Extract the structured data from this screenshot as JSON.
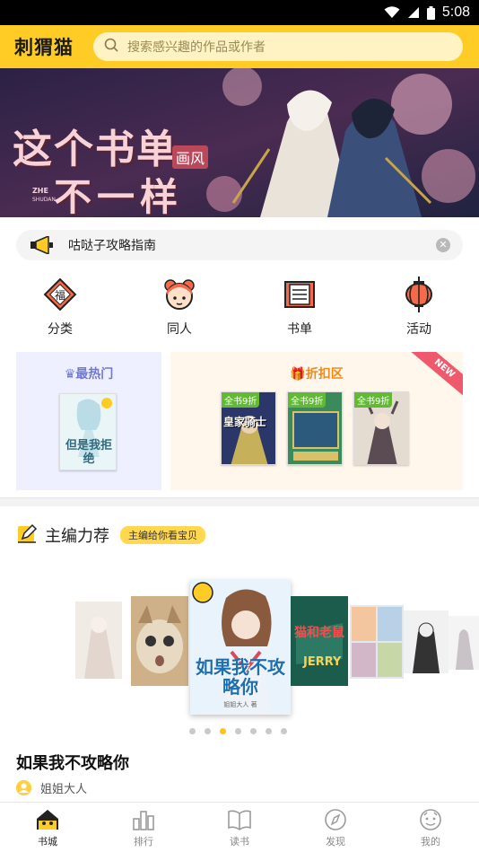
{
  "status_bar": {
    "time": "5:08"
  },
  "header": {
    "logo": "刺猬猫",
    "search_placeholder": "搜索感兴趣的作品或作者"
  },
  "banner": {
    "headline_1": "这个书单",
    "headline_2": "不一样",
    "badge": "画风",
    "tag_small_1": "ZHE",
    "tag_small_2": "SHUDAN"
  },
  "notice": {
    "text": "咕哒子攻略指南"
  },
  "categories": [
    {
      "label": "分类",
      "icon": "fortune-icon"
    },
    {
      "label": "同人",
      "icon": "character-icon"
    },
    {
      "label": "书单",
      "icon": "scroll-icon"
    },
    {
      "label": "活动",
      "icon": "lantern-icon"
    }
  ],
  "hot": {
    "title": "最热门",
    "book_title": "但是我拒绝"
  },
  "discount": {
    "title": "折扣区",
    "ribbon": "NEW",
    "books": [
      {
        "tag": "全书9折",
        "cover_text": "皇家骑士"
      },
      {
        "tag": "全书9折",
        "cover_text": ""
      },
      {
        "tag": "全书9折",
        "cover_text": ""
      }
    ]
  },
  "editor_picks": {
    "title": "主编力荐",
    "badge": "主编给你看宝贝",
    "featured_cover_title": "如果我不攻略你",
    "featured_cover_author": "姐姐大人 著",
    "cover_text_jerry": "猫和老鼠",
    "cover_text_jerry_en": "JERRY",
    "dots": {
      "count": 7,
      "active_index": 2
    },
    "book_title": "如果我不攻略你",
    "author": "姐姐大人"
  },
  "tabs": [
    {
      "label": "书城",
      "icon": "home-icon",
      "active": true
    },
    {
      "label": "排行",
      "icon": "chart-icon",
      "active": false
    },
    {
      "label": "读书",
      "icon": "book-icon",
      "active": false
    },
    {
      "label": "发现",
      "icon": "compass-icon",
      "active": false
    },
    {
      "label": "我的",
      "icon": "profile-icon",
      "active": false
    }
  ],
  "colors": {
    "accent": "#ffcc26",
    "hot_title": "#6f7ad1",
    "discount_title": "#f28a19",
    "tag_green": "#63b935",
    "ribbon": "#f0586c"
  }
}
